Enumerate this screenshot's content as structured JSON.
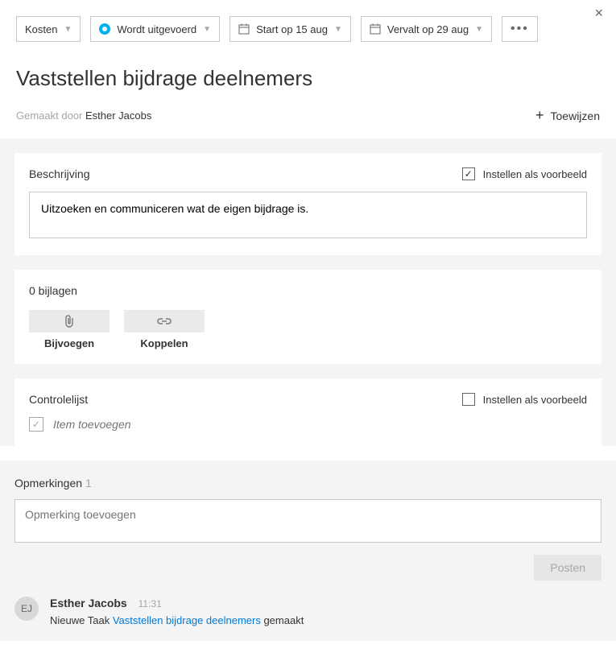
{
  "toolbar": {
    "bucket_label": "Kosten",
    "status_label": "Wordt uitgevoerd",
    "start_label": "Start op 15 aug",
    "due_label": "Vervalt op 29 aug"
  },
  "title": "Vaststellen bijdrage deelnemers",
  "created_by_prefix": "Gemaakt door ",
  "created_by_name": "Esther Jacobs",
  "assign_label": "Toewijzen",
  "description": {
    "heading": "Beschrijving",
    "example_label": "Instellen als voorbeeld",
    "value": "Uitzoeken en communiceren wat de eigen bijdrage is."
  },
  "attachments": {
    "count_label": "0 bijlagen",
    "attach_label": "Bijvoegen",
    "link_label": "Koppelen"
  },
  "checklist": {
    "heading": "Controlelijst",
    "example_label": "Instellen als voorbeeld",
    "add_placeholder": "Item toevoegen"
  },
  "comments": {
    "heading": "Opmerkingen",
    "count": "1",
    "placeholder": "Opmerking toevoegen",
    "post_label": "Posten"
  },
  "activity": {
    "avatar_initials": "EJ",
    "author": "Esther Jacobs",
    "time": "11:31",
    "msg_prefix": "Nieuwe Taak ",
    "msg_link": "Vaststellen bijdrage deelnemers",
    "msg_suffix": " gemaakt"
  }
}
